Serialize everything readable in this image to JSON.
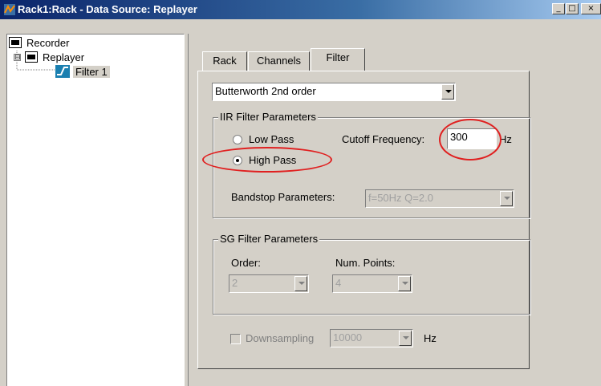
{
  "window": {
    "title": "Rack1:Rack - Data Source: Replayer",
    "minimize_glyph": "_",
    "maximize_glyph": "□",
    "close_glyph": "×"
  },
  "tree": {
    "items": [
      {
        "label": "Recorder",
        "icon": "recorder-icon"
      },
      {
        "label": "Replayer",
        "icon": "replayer-icon",
        "expander": "⊟"
      },
      {
        "label": "Filter 1",
        "icon": "filter-icon",
        "selected": true
      }
    ]
  },
  "tabs": [
    {
      "label": "Rack"
    },
    {
      "label": "Channels"
    },
    {
      "label": "Filter",
      "active": true
    }
  ],
  "filter": {
    "type_selected": "Butterworth 2nd order",
    "iir": {
      "title": "IIR Filter Parameters",
      "low_pass_label": "Low Pass",
      "high_pass_label": "High Pass",
      "selected": "High Pass",
      "cutoff_label": "Cutoff Frequency:",
      "cutoff_value": "300",
      "cutoff_unit": "Hz",
      "bandstop_label": "Bandstop Parameters:",
      "bandstop_value": "f=50Hz Q=2.0"
    },
    "sg": {
      "title": "SG Filter Parameters",
      "order_label": "Order:",
      "order_value": "2",
      "num_points_label": "Num. Points:",
      "num_points_value": "4"
    },
    "downsampling": {
      "label": "Downsampling",
      "value": "10000",
      "unit": "Hz",
      "checked": false
    }
  },
  "annotation_color": "#e02020"
}
